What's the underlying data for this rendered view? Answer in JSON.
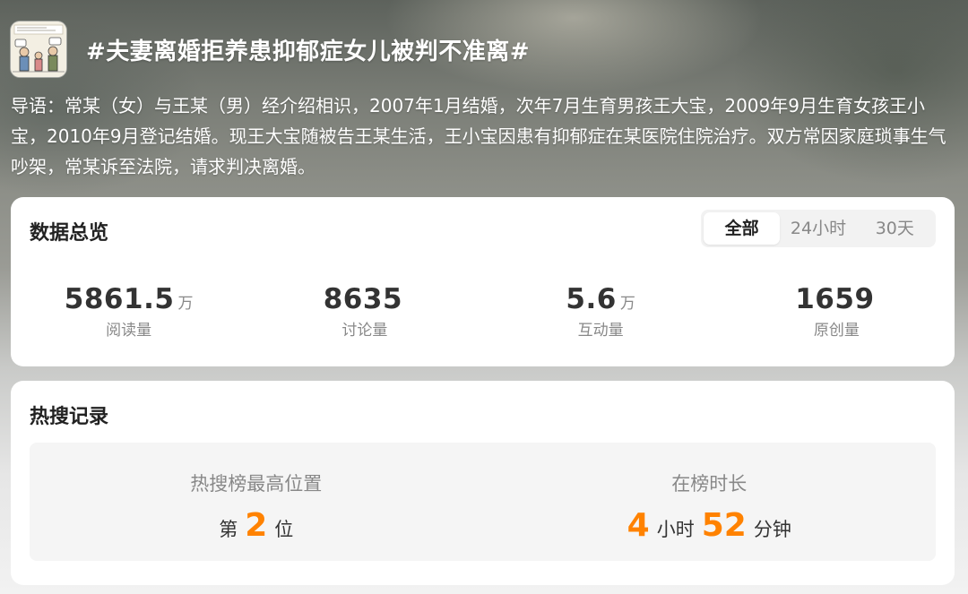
{
  "topic": {
    "title": "#夫妻离婚拒养患抑郁症女儿被判不准离#",
    "thumbnail_icon": "comic-thumbnail-icon"
  },
  "intro": "导语：常某（女）与王某（男）经介绍相识，2007年1月结婚，次年7月生育男孩王大宝，2009年9月生育女孩王小宝，2010年9月登记结婚。现王大宝随被告王某生活，王小宝因患有抑郁症在某医院住院治疗。双方常因家庭琐事生气吵架，常某诉至法院，请求判决离婚。",
  "overview": {
    "title": "数据总览",
    "tabs": [
      {
        "label": "全部",
        "active": true
      },
      {
        "label": "24小时",
        "active": false
      },
      {
        "label": "30天",
        "active": false
      }
    ],
    "stats": [
      {
        "value": "5861.5",
        "unit": "万",
        "label": "阅读量"
      },
      {
        "value": "8635",
        "unit": "",
        "label": "讨论量"
      },
      {
        "value": "5.6",
        "unit": "万",
        "label": "互动量"
      },
      {
        "value": "1659",
        "unit": "",
        "label": "原创量"
      }
    ]
  },
  "hot_search": {
    "title": "热搜记录",
    "peak": {
      "label": "热搜榜最高位置",
      "prefix": "第",
      "value": "2",
      "suffix": "位"
    },
    "duration": {
      "label": "在榜时长",
      "hours": "4",
      "hours_unit": "小时",
      "minutes": "52",
      "minutes_unit": "分钟"
    }
  },
  "colors": {
    "accent": "#ff8200",
    "card_bg": "#ffffff",
    "muted_text": "#888888"
  }
}
